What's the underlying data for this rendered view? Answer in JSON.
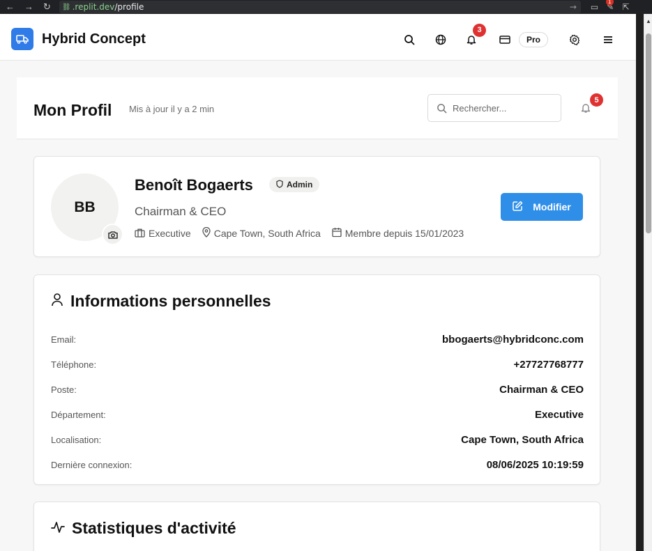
{
  "browser": {
    "url_host": ".replit.dev",
    "url_path": "/profile",
    "ext_badge": "1"
  },
  "header": {
    "brand": "Hybrid Concept",
    "notif_count": "3",
    "plan": "Pro"
  },
  "page": {
    "title": "Mon Profil",
    "updated": "Mis à jour il y a 2 min",
    "search_placeholder": "Rechercher...",
    "alert_count": "5"
  },
  "profile": {
    "initials": "BB",
    "name": "Benoît Bogaerts",
    "role_badge": "Admin",
    "title": "Chairman & CEO",
    "department": "Executive",
    "location": "Cape Town, South Africa",
    "member_since": "Membre depuis 15/01/2023",
    "edit_label": "Modifier"
  },
  "personal_info": {
    "heading": "Informations personnelles",
    "rows": [
      {
        "label": "Email:",
        "value": "bbogaerts@hybridconc.com"
      },
      {
        "label": "Téléphone:",
        "value": "+27727768777"
      },
      {
        "label": "Poste:",
        "value": "Chairman & CEO"
      },
      {
        "label": "Département:",
        "value": "Executive"
      },
      {
        "label": "Localisation:",
        "value": "Cape Town, South Africa"
      },
      {
        "label": "Dernière connexion:",
        "value": "08/06/2025 10:19:59"
      }
    ]
  },
  "stats": {
    "heading": "Statistiques d'activité"
  }
}
